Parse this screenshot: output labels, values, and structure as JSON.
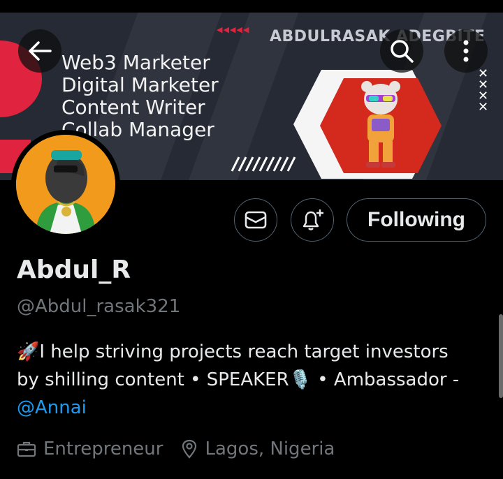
{
  "banner": {
    "owner_text": "ABDULRASAK ADEGBITE",
    "roles": [
      "Web3 Marketer",
      "Digital Marketer",
      "Content Writer",
      "Collab Manager"
    ],
    "arrows": "◀◀◀◀◀"
  },
  "navigation": {
    "back_icon": "arrow-left-icon",
    "search_icon": "search-icon",
    "more_icon": "more-vertical-icon"
  },
  "actions": {
    "message_icon": "envelope-icon",
    "notify_icon": "bell-plus-icon",
    "follow_label": "Following"
  },
  "profile": {
    "display_name": "Abdul_R",
    "handle": "@Abdul_rasak321",
    "bio_prefix": "🚀",
    "bio_line1": "I help striving projects reach target investors",
    "bio_line2_a": "by shilling content • SPEAKER",
    "bio_mic": "🎙️",
    "bio_line2_b": " • Ambassador -",
    "bio_mention": "@Annai",
    "profession": "Entrepreneur",
    "location": "Lagos, Nigeria"
  },
  "colors": {
    "accent": "#1d9bf0",
    "background": "#000000",
    "banner_red": "#e0243f",
    "avatar_bg": "#f29a1b"
  }
}
